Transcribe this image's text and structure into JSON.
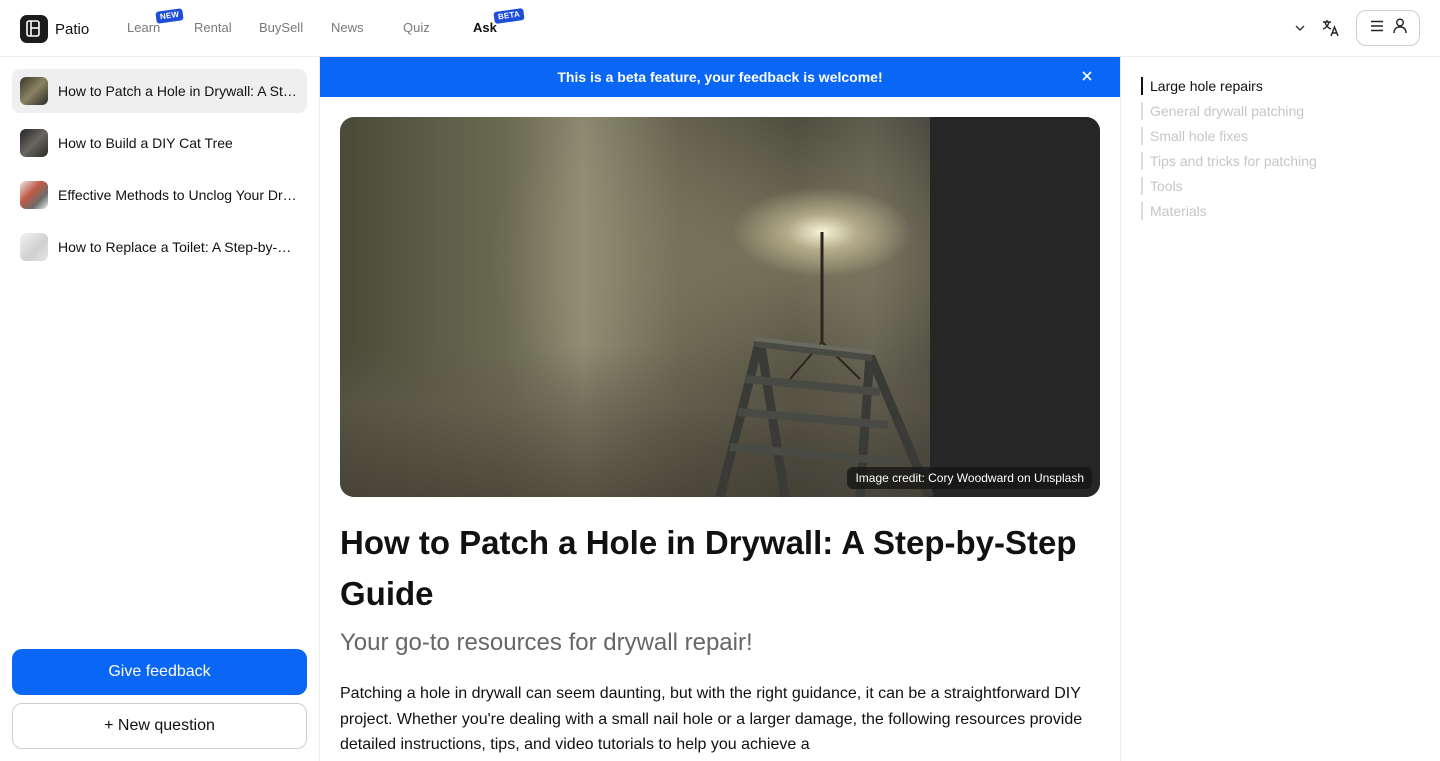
{
  "app": {
    "name": "Patio"
  },
  "nav": {
    "items": [
      {
        "label": "Learn",
        "badge": "NEW"
      },
      {
        "label": "Rental",
        "badge": ""
      },
      {
        "label": "BuySell",
        "badge": ""
      },
      {
        "label": "News",
        "badge": ""
      },
      {
        "label": "Quiz",
        "badge": ""
      },
      {
        "label": "Ask",
        "badge": "BETA"
      }
    ],
    "active": "Ask"
  },
  "header": {
    "icons": [
      "chevron-down-icon",
      "translate-icon",
      "hamburger-icon",
      "user-icon"
    ]
  },
  "sidebar": {
    "history": [
      {
        "label": "How to Patch a Hole in Drywall: A Step-by-Step Guide",
        "thumb_color": "#5a5446"
      },
      {
        "label": "How to Build a DIY Cat Tree",
        "thumb_color": "#3b3a38"
      },
      {
        "label": "Effective Methods to Unclog Your Drain",
        "thumb_color": "#b45a4a"
      },
      {
        "label": "How to Replace a Toilet: A Step-by-Step Guide",
        "thumb_color": "#d6d6d6"
      }
    ],
    "feedback_label": "Give feedback",
    "new_question_label": "+ New question"
  },
  "beta_banner": {
    "text": "This is a beta feature, your feedback is welcome!"
  },
  "article": {
    "image_credit": "Image credit: Cory Woodward on Unsplash",
    "title": "How to Patch a Hole in Drywall: A Step-by-Step Guide",
    "subtitle": "Your go-to resources for drywall repair!",
    "body": "Patching a hole in drywall can seem daunting, but with the right guidance, it can be a straightforward DIY project. Whether you're dealing with a small nail hole or a larger damage, the following resources provide detailed instructions, tips, and video tutorials to help you achieve a"
  },
  "toc": {
    "items": [
      "Large hole repairs",
      "General drywall patching",
      "Small hole fixes",
      "Tips and tricks for patching",
      "Tools",
      "Materials"
    ],
    "active_index": 0
  },
  "colors": {
    "accent": "#0a66f5",
    "badge": "#1d4ed8"
  }
}
